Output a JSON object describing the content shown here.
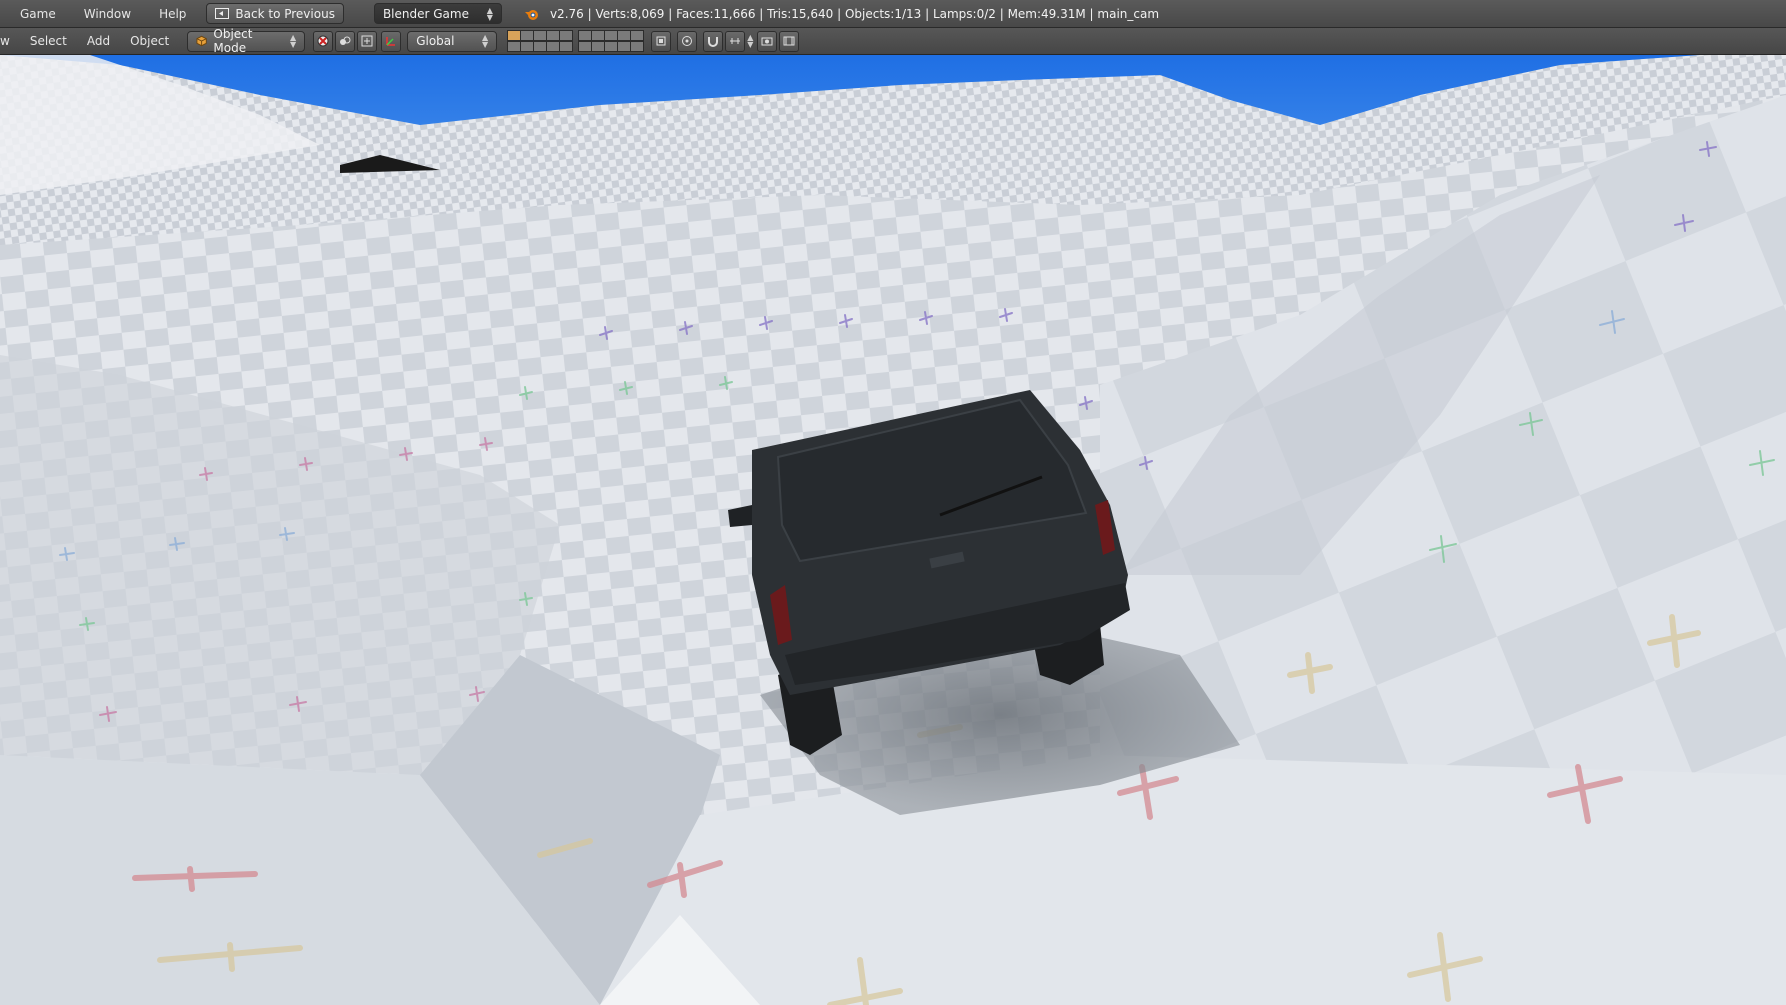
{
  "top_menu": {
    "items": [
      "Game",
      "Window",
      "Help"
    ],
    "back_button": "Back to Previous",
    "engine": "Blender Game",
    "stats": "v2.76 | Verts:8,069 | Faces:11,666 | Tris:15,640 | Objects:1/13 | Lamps:0/2 | Mem:49.31M | main_cam"
  },
  "view_header": {
    "view_label": "w",
    "menus": [
      "Select",
      "Add",
      "Object"
    ],
    "mode": "Object Mode",
    "orientation": "Global"
  },
  "colors": {
    "sky": "#2f7de6",
    "ground": "#dde2e8",
    "vehicle": "#2b2f33"
  }
}
